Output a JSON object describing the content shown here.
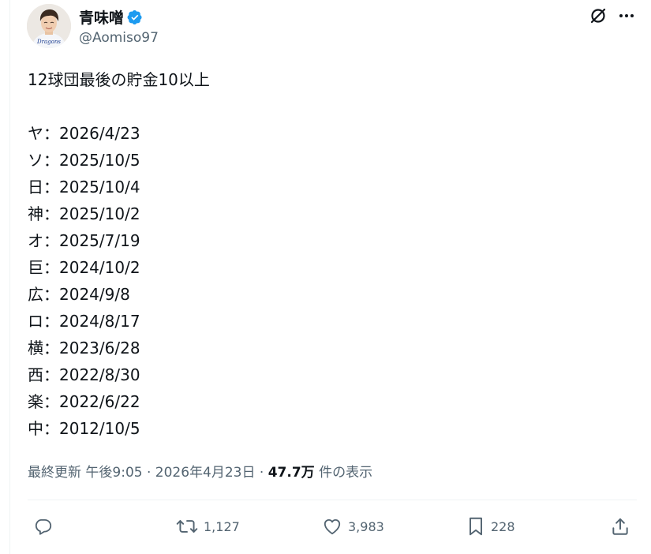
{
  "author": {
    "display_name": "青味噌",
    "handle": "@Aomiso97",
    "avatar_icon": "user-avatar-photo",
    "verified_icon": "verified-badge-icon",
    "verified_color": "#1d9bf0"
  },
  "header_actions": {
    "grok_icon": "grok-icon",
    "more_icon": "more-icon"
  },
  "post": {
    "headline": "12球団最後の貯金10以上",
    "lines": [
      "ヤ：2026/4/23",
      "ソ：2025/10/5",
      "日：2025/10/4",
      "神：2025/10/2",
      "オ：2025/7/19",
      "巨：2024/10/2",
      "広：2024/9/8",
      "ロ：2024/8/17",
      "横：2023/6/28",
      "西：2022/8/30",
      "楽：2022/6/22",
      "中：2012/10/5"
    ]
  },
  "meta": {
    "prefix": "最終更新 午後9:05 · 2026年4月23日 · ",
    "views": "47.7万",
    "views_suffix": " 件の表示"
  },
  "actions": {
    "reply_icon": "reply-icon",
    "repost_icon": "repost-icon",
    "repost_count": "1,127",
    "like_icon": "heart-icon",
    "like_count": "3,983",
    "bookmark_icon": "bookmark-icon",
    "bookmark_count": "228",
    "share_icon": "share-icon"
  },
  "colors": {
    "text_primary": "#0f1419",
    "text_secondary": "#536471",
    "divider": "#eff3f4"
  }
}
